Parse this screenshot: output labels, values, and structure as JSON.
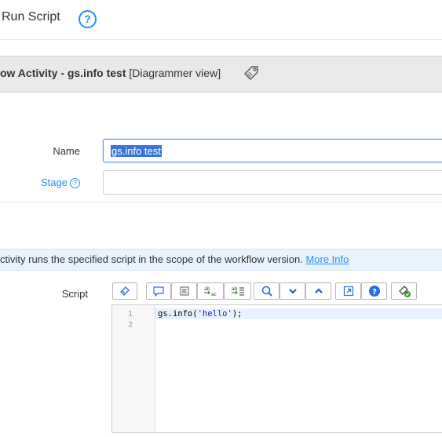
{
  "header": {
    "title": "Run Script",
    "help_glyph": "?"
  },
  "activity": {
    "title_bold": "ow Activity - gs.info test",
    "title_normal": " [Diagrammer view]",
    "icon": "tag-icon"
  },
  "form": {
    "name_label": "Name",
    "name_value": "gs.info test",
    "stage_label": "Stage",
    "stage_value": ""
  },
  "info": {
    "text": "ctivity runs the specified script in the scope of the workflow version. ",
    "link": "More Info"
  },
  "script": {
    "label": "Script",
    "toolbar": [
      "toggle-syntax-icon",
      "comment-icon",
      "format-icon",
      "replace-icon",
      "replace-all-icon",
      "search-icon",
      "chevron-down-icon",
      "chevron-up-icon",
      "fullscreen-icon",
      "help-icon",
      "script-check-icon"
    ],
    "line_numbers": [
      "1",
      "2"
    ],
    "code_prefix": "gs.info(",
    "code_string": "'hello'",
    "code_suffix": ");"
  },
  "colors": {
    "accent": "#278efc",
    "selection": "#3875d7",
    "header_bg": "#e9e9e9",
    "info_bg": "#e8f3fc"
  }
}
